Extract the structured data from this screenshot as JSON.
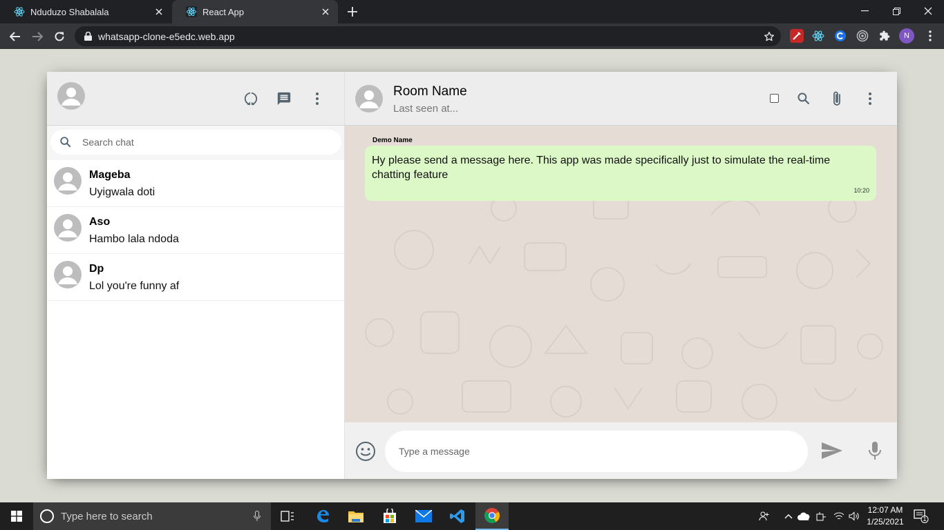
{
  "browser": {
    "tabs": [
      {
        "title": "Nduduzo Shabalala",
        "active": false
      },
      {
        "title": "React App",
        "active": true
      }
    ],
    "url": "whatsapp-clone-e5edc.web.app",
    "profile_initial": "N"
  },
  "sidebar": {
    "search_placeholder": "Search chat",
    "chats": [
      {
        "name": "Mageba",
        "last_message": "Uyigwala doti"
      },
      {
        "name": "Aso",
        "last_message": "Hambo lala ndoda"
      },
      {
        "name": "Dp",
        "last_message": "Lol you're funny af"
      }
    ]
  },
  "chat": {
    "room_name": "Room Name",
    "last_seen": "Last seen at...",
    "messages": [
      {
        "sender": "Demo Name",
        "text": "Hy please send a message here. This app was made specifically just to simulate the real-time chatting feature",
        "time": "10:20"
      }
    ],
    "input_placeholder": "Type a message"
  },
  "taskbar": {
    "search_placeholder": "Type here to search",
    "time": "12:07 AM",
    "date": "1/25/2021",
    "notification_count": "1"
  },
  "colors": {
    "bubble": "#dcf8c6",
    "chat_bg": "#e5ddd5",
    "header_bg": "#ededed",
    "icon_gray": "#919191"
  },
  "icons": [
    "react-icon",
    "close-icon",
    "plus-icon",
    "minimize-icon",
    "restore-icon",
    "back-arrow-icon",
    "forward-arrow-icon",
    "reload-icon",
    "lock-icon",
    "star-icon",
    "avatar-icon",
    "status-ring-icon",
    "new-chat-icon",
    "more-vert-icon",
    "search-icon",
    "attach-icon",
    "emoji-icon",
    "send-icon",
    "mic-icon",
    "windows-icon"
  ]
}
